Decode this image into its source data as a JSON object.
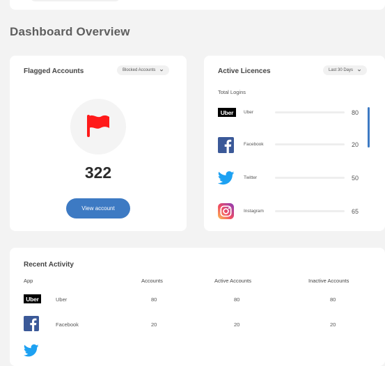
{
  "page": {
    "title": "Dashboard Overview"
  },
  "flagged": {
    "title": "Flagged Accounts",
    "filter": "Blocked Accounts",
    "count": "322",
    "button_label": "View account",
    "flag_color": "#ff1a1a"
  },
  "licences": {
    "title": "Active Licences",
    "filter": "Last 30 Days",
    "subtitle": "Total Logins",
    "items": [
      {
        "name": "Uber",
        "value": "80",
        "icon": "uber-logo",
        "progress": 0
      },
      {
        "name": "Facebook",
        "value": "20",
        "icon": "facebook-logo",
        "progress": 0
      },
      {
        "name": "Twitter",
        "value": "50",
        "icon": "twitter-logo",
        "progress": 0
      },
      {
        "name": "Instagram",
        "value": "65",
        "icon": "instagram-logo",
        "progress": 0
      }
    ]
  },
  "activity": {
    "title": "Recent Activity",
    "columns": [
      "App",
      "Accounts",
      "Active Accounts",
      "Inactive Accounts"
    ],
    "rows": [
      {
        "app": "Uber",
        "icon": "uber-logo",
        "accounts": "80",
        "active": "80",
        "inactive": "80"
      },
      {
        "app": "Facebook",
        "icon": "facebook-logo",
        "accounts": "20",
        "active": "20",
        "inactive": "20"
      }
    ]
  },
  "colors": {
    "accent": "#3d7ac3",
    "facebook": "#3b5998",
    "twitter": "#1da1f2",
    "background": "#f3f3f3"
  },
  "brand_text": {
    "uber": "Uber"
  }
}
